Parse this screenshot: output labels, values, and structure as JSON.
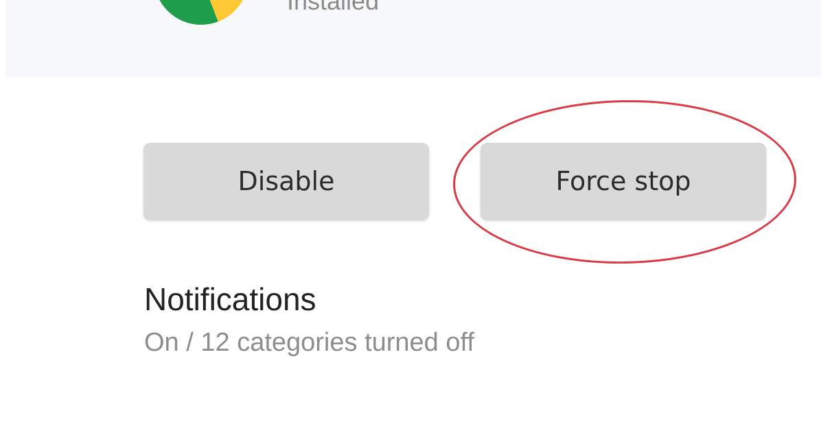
{
  "app_header": {
    "status": "Installed",
    "icon": "chrome-app-icon",
    "icon_colors": {
      "green": "#1e9e4a",
      "yellow": "#fcc934",
      "red": "#d93025"
    }
  },
  "actions": {
    "disable_label": "Disable",
    "force_stop_label": "Force stop",
    "button_color": "#d9d9d9",
    "highlight_color": "#d93a45"
  },
  "notifications": {
    "title": "Notifications",
    "summary": "On / 12 categories turned off"
  }
}
